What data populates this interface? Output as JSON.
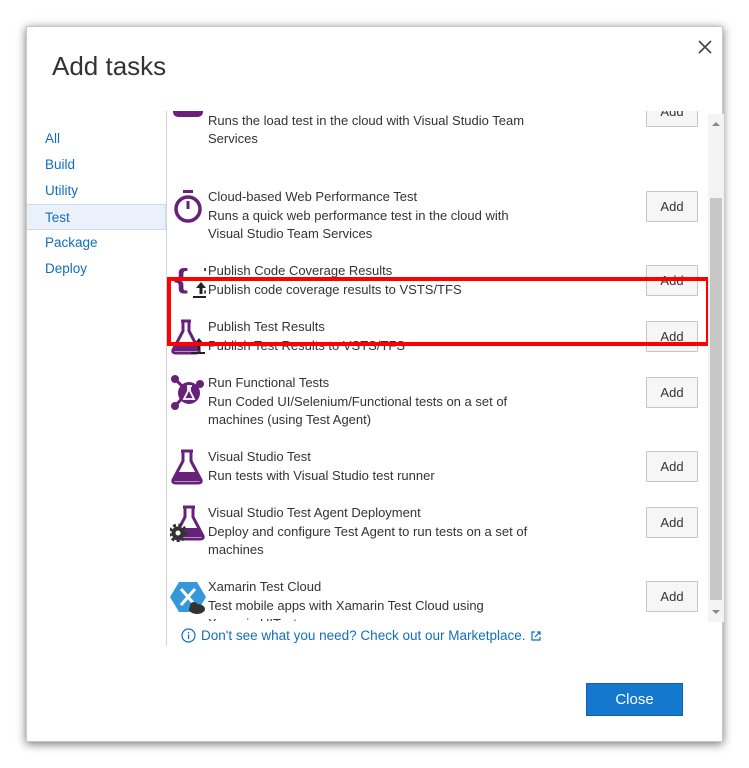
{
  "dialog": {
    "title": "Add tasks",
    "close_button_label": "Close"
  },
  "nav": {
    "items": [
      {
        "label": "All"
      },
      {
        "label": "Build"
      },
      {
        "label": "Utility"
      },
      {
        "label": "Test",
        "active": true
      },
      {
        "label": "Package"
      },
      {
        "label": "Deploy"
      }
    ]
  },
  "tasks": [
    {
      "name": "",
      "description": "Runs the load test in the cloud with Visual Studio Team Services",
      "add_label": "Add",
      "icon": "cloud-load-test-icon"
    },
    {
      "name": "Cloud-based Web Performance Test",
      "description": "Runs a quick web performance test in the cloud with Visual Studio Team Services",
      "add_label": "Add",
      "icon": "stopwatch-icon"
    },
    {
      "name": "Publish Code Coverage Results",
      "description": "Publish code coverage results to VSTS/TFS",
      "add_label": "Add",
      "icon": "curly-braces-upload-icon"
    },
    {
      "name": "Publish Test Results",
      "description": "Publish Test Results to VSTS/TFS",
      "add_label": "Add",
      "icon": "flask-upload-icon"
    },
    {
      "name": "Run Functional Tests",
      "description": "Run Coded UI/Selenium/Functional tests on a set of machines (using Test Agent)",
      "add_label": "Add",
      "icon": "flask-network-icon"
    },
    {
      "name": "Visual Studio Test",
      "description": "Run tests with Visual Studio test runner",
      "add_label": "Add",
      "icon": "flask-icon"
    },
    {
      "name": "Visual Studio Test Agent Deployment",
      "description": "Deploy and configure Test Agent to run tests on a set of machines",
      "add_label": "Add",
      "icon": "flask-gear-icon"
    },
    {
      "name": "Xamarin Test Cloud",
      "description": "Test mobile apps with Xamarin Test Cloud using Xamarin.UITest",
      "add_label": "Add",
      "icon": "xamarin-icon"
    }
  ],
  "marketplace_link": "Don't see what you need? Check out our Marketplace.",
  "colors": {
    "accent": "#106ebe",
    "primary_button": "#1478cf",
    "icon_purple": "#68217a",
    "highlight": "#ff0000"
  }
}
